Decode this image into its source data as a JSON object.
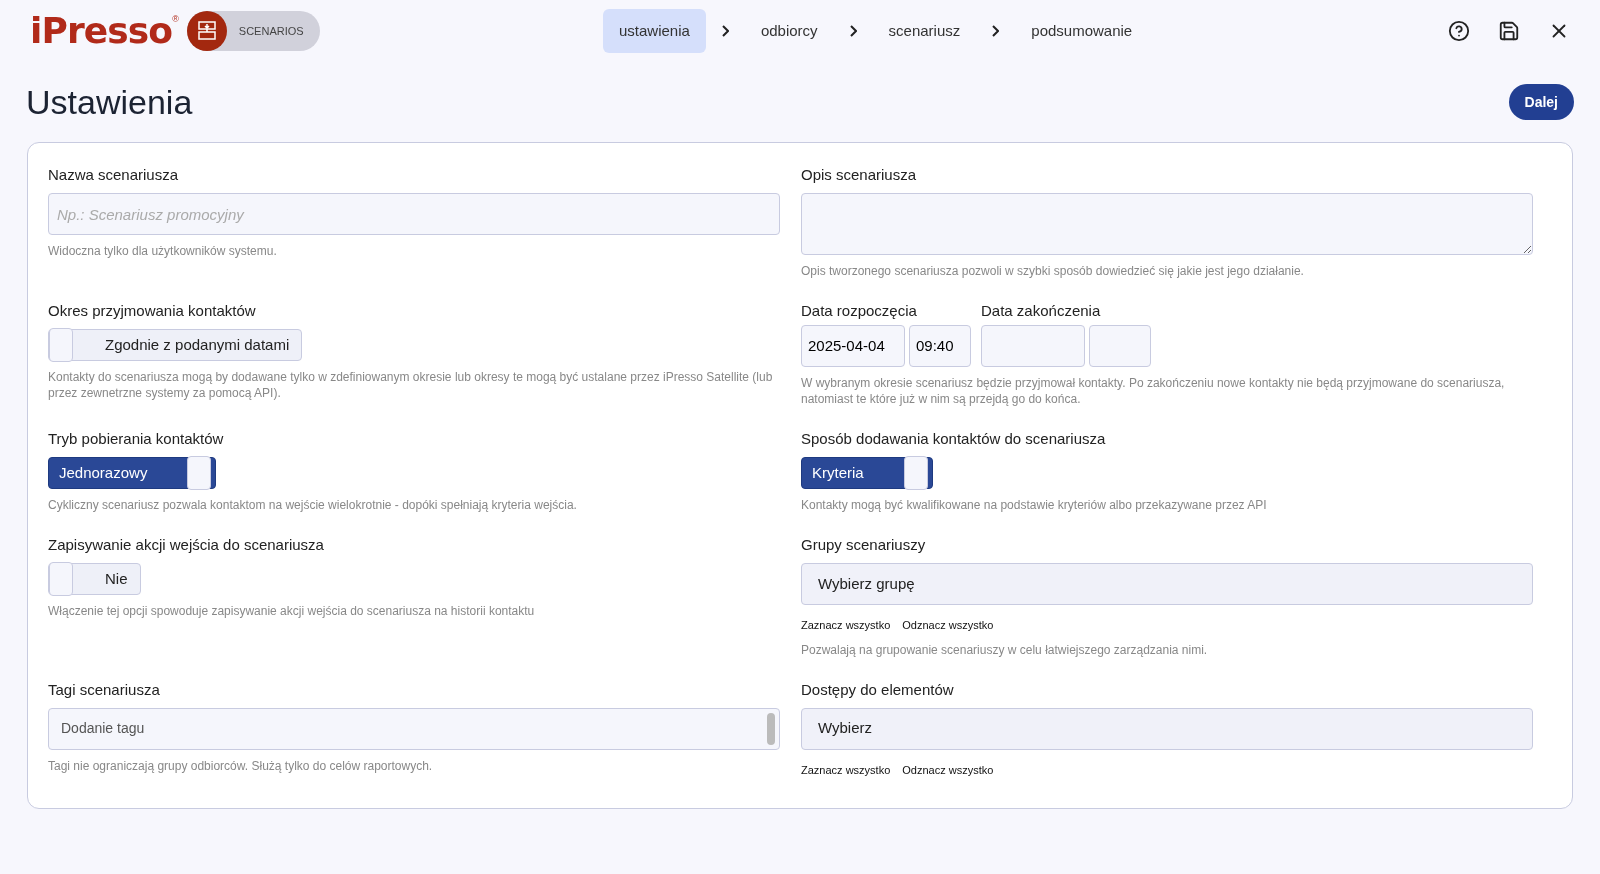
{
  "header": {
    "logo": "iPresso",
    "logo_mark": "®",
    "module": "SCENARIOS",
    "steps": [
      {
        "label": "ustawienia",
        "selected": true
      },
      {
        "label": "odbiorcy",
        "selected": false
      },
      {
        "label": "scenariusz",
        "selected": false
      },
      {
        "label": "podsumowanie",
        "selected": false
      }
    ]
  },
  "page": {
    "title": "Ustawienia",
    "next_button": "Dalej"
  },
  "form": {
    "rows": [
      [
        {
          "kind": "input",
          "label": "Nazwa scenariusza",
          "placeholder": "Np.: Scenariusz promocyjny",
          "hint": "Widoczna tylko dla użytkowników systemu."
        },
        {
          "kind": "textarea",
          "label": "Opis scenariusza",
          "hint": "Opis tworzonego scenariusza pozwoli w szybki sposób dowiedzieć się jakie jest jego działanie."
        }
      ],
      [
        {
          "kind": "toggle",
          "label": "Okres przyjmowania kontaktów",
          "on": false,
          "value": "Zgodnie z podanymi datami",
          "hint": "Kontakty do scenariusza mogą by dodawane tylko w zdefiniowanym okresie lub okresy te mogą być ustalane przez iPresso Satellite (lub przez zewnetrzne systemy za pomocą API)."
        },
        {
          "kind": "dates",
          "start": {
            "label": "Data rozpoczęcia",
            "date": "2025-04-04",
            "time": "09:40"
          },
          "end": {
            "label": "Data zakończenia"
          },
          "hint": "W wybranym okresie scenariusz będzie przyjmował kontakty. Po zakończeniu nowe kontakty nie będą przyjmowane do scenariusza, natomiast te które już w nim są przejdą go do końca."
        }
      ],
      [
        {
          "kind": "toggle",
          "label": "Tryb pobierania kontaktów",
          "on": true,
          "value": "Jednorazowy",
          "hint": "Cykliczny scenariusz pozwala kontaktom na wejście wielokrotnie - dopóki spełniają kryteria wejścia."
        },
        {
          "kind": "toggle",
          "label": "Sposób dodawania kontaktów do scenariusza",
          "on": true,
          "value": "Kryteria",
          "hint": "Kontakty mogą być kwalifikowane na podstawie kryteriów albo przekazywane przez API"
        }
      ],
      [
        {
          "kind": "toggle",
          "label": "Zapisywanie akcji wejścia do scenariusza",
          "on": false,
          "value": "Nie",
          "hint": "Włączenie tej opcji spowoduje zapisywanie akcji wejścia do scenariusza na historii kontaktu"
        },
        {
          "kind": "select",
          "label": "Grupy scenariuszy",
          "value": "Wybierz grupę",
          "links": [
            "Zaznacz wszystko",
            "Odznacz wszystko"
          ],
          "hint": "Pozwalają na grupowanie scenariuszy w celu łatwiejszego zarządzania nimi."
        }
      ],
      [
        {
          "kind": "tags",
          "label": "Tagi scenariusza",
          "placeholder": "Dodanie tagu",
          "hint": "Tagi nie ograniczają grupy odbiorców. Służą tylko do celów raportowych."
        },
        {
          "kind": "select",
          "label": "Dostępy do elementów",
          "value": "Wybierz",
          "links": [
            "Zaznacz wszystko",
            "Odznacz wszystko"
          ]
        }
      ]
    ]
  }
}
